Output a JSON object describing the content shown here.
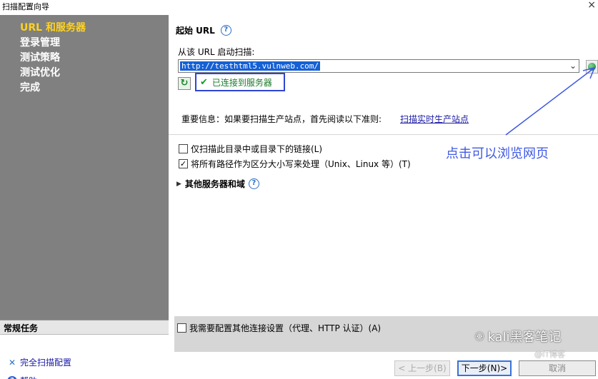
{
  "window": {
    "title": "扫描配置向导",
    "close_glyph": "×"
  },
  "steps": [
    {
      "label": "URL 和服务器",
      "active": true
    },
    {
      "label": "登录管理",
      "active": false
    },
    {
      "label": "测试策略",
      "active": false
    },
    {
      "label": "测试优化",
      "active": false
    },
    {
      "label": "完成",
      "active": false
    }
  ],
  "tasks": {
    "header": "常规任务",
    "items": [
      {
        "label": "完全扫描配置",
        "icon": "tools-icon"
      },
      {
        "label": "帮助",
        "icon": "help-icon"
      }
    ]
  },
  "main": {
    "section_title": "起始 URL",
    "start_label": "从该 URL 启动扫描:",
    "url_value": "http://testhtml5.vulnweb.com/",
    "conn_status": "已连接到服务器",
    "important_text": "重要信息：如果要扫描生产站点，首先阅读以下准则:",
    "important_link": "扫描实时生产站点",
    "options": [
      {
        "label": "仅扫描此目录中或目录下的链接(L)",
        "checked": false
      },
      {
        "label": "将所有路径作为区分大小写来处理（Unix、Linux 等）(T)",
        "checked": true
      }
    ],
    "more_label": "其他服务器和域",
    "annotation": "点击可以浏览网页",
    "bottom_option": {
      "label": "我需要配置其他连接设置（代理、HTTP 认证）(A)",
      "checked": false
    }
  },
  "buttons": {
    "prev": "< 上一步(B)",
    "next": "下一步(N)>",
    "cancel": "取消"
  },
  "watermark": {
    "main": "kali黑客笔记",
    "small": "@IT博客"
  },
  "colors": {
    "sidebar_bg": "#808080",
    "active_step": "#ffd21f",
    "annotation": "#3e58e6",
    "link": "#1a1aa6",
    "selection": "#1560d6"
  }
}
